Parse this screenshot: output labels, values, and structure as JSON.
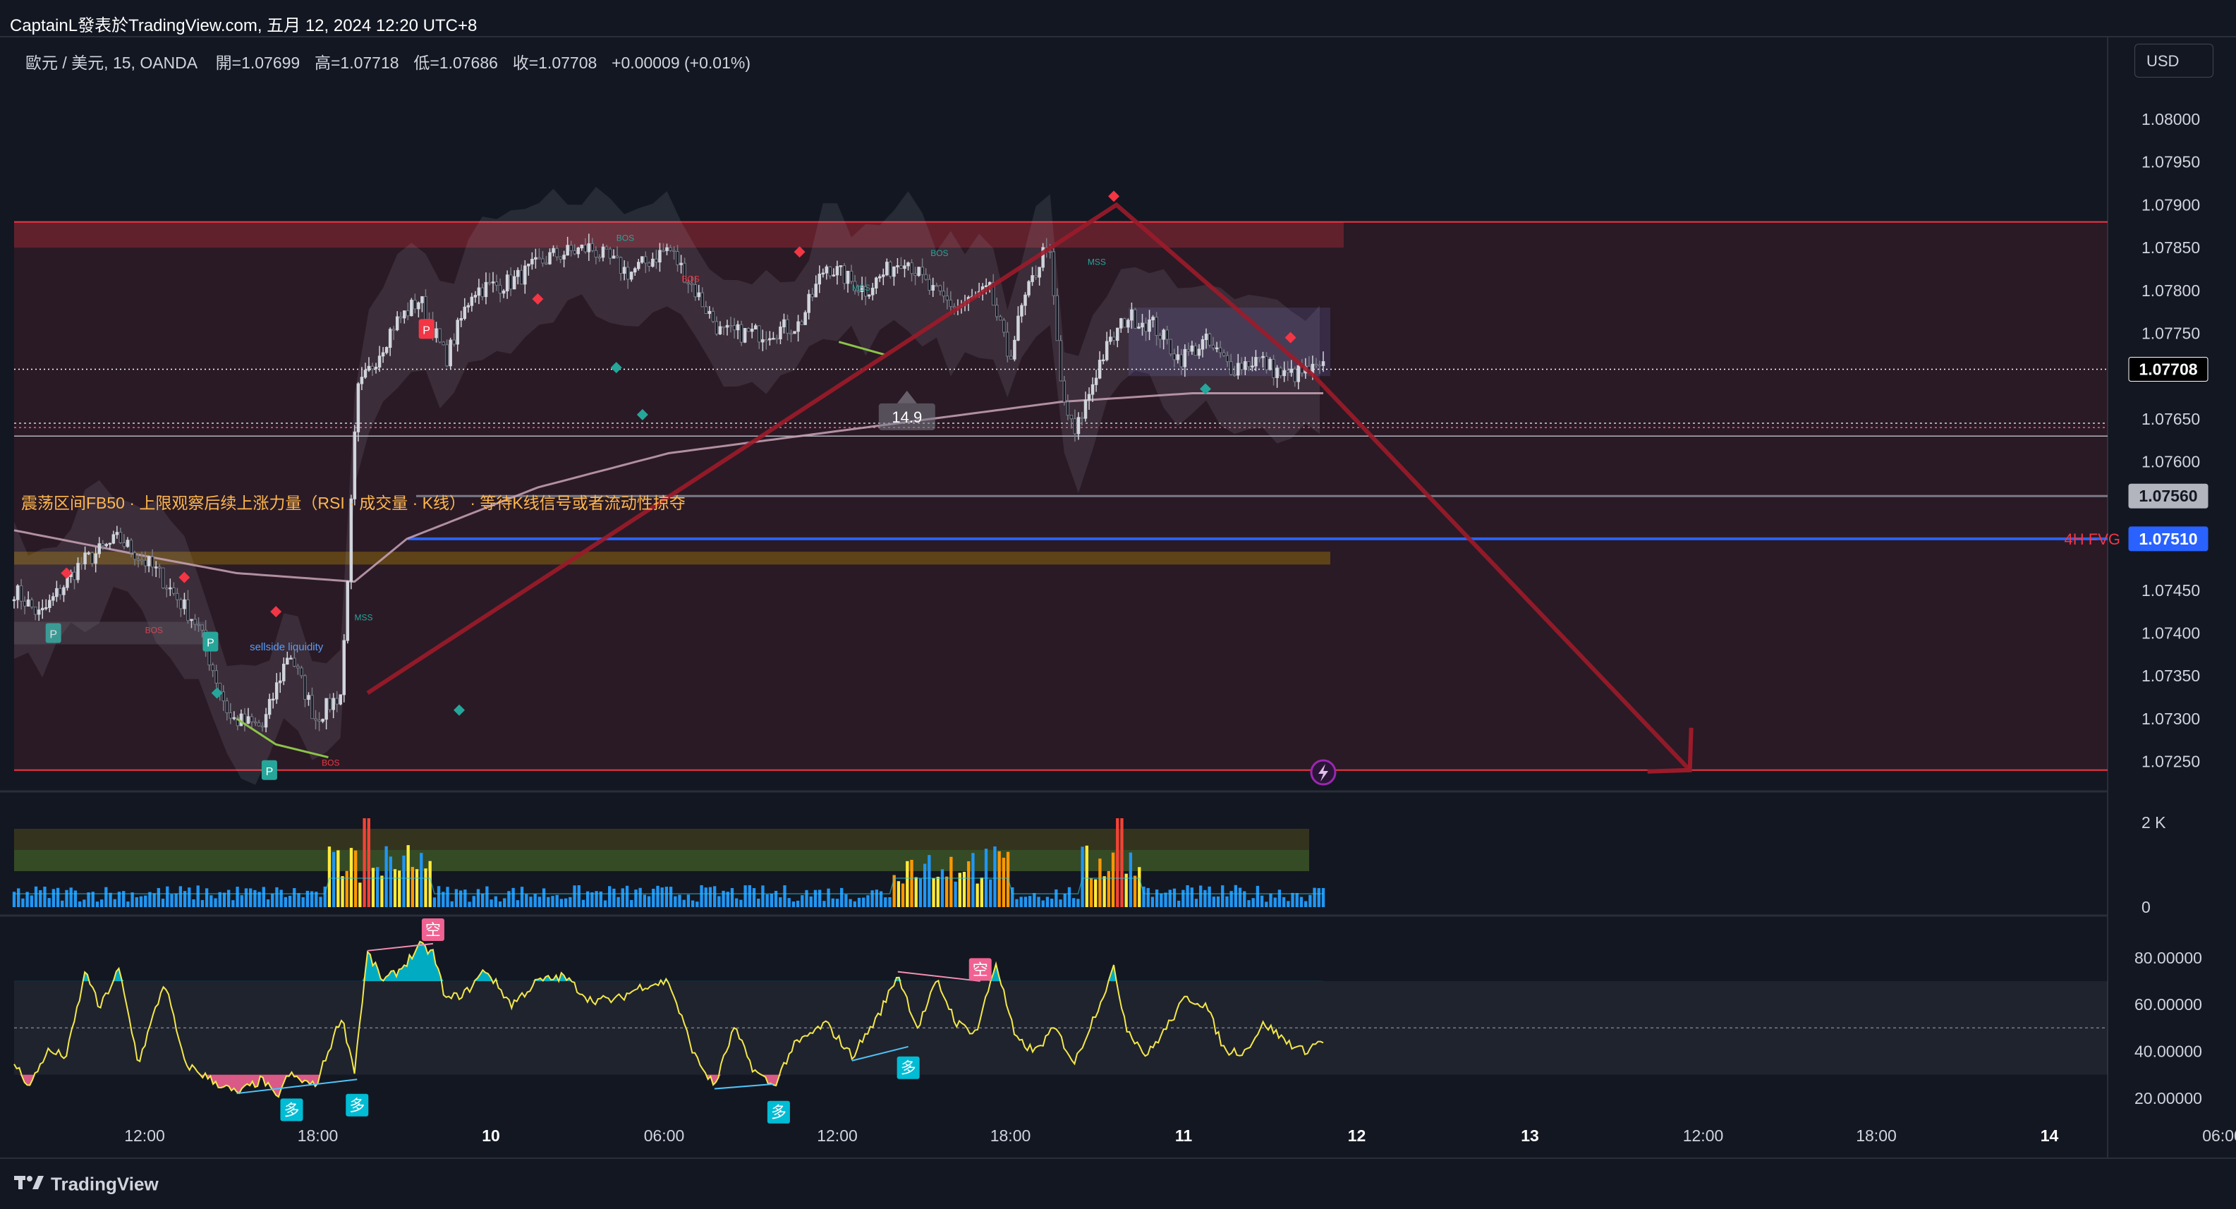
{
  "header": {
    "published": "CaptainL發表於TradingView.com, 五月 12, 2024 12:20 UTC+8",
    "symbol": "歐元 / 美元, 15, OANDA",
    "open_label": "開=",
    "open": "1.07699",
    "high_label": "高=",
    "high": "1.07718",
    "low_label": "低=",
    "low": "1.07686",
    "close_label": "收=",
    "close": "1.07708",
    "change": "+0.00009 (+0.01%)"
  },
  "currency_button": "USD",
  "footer": {
    "logo_text": "TradingView"
  },
  "annotations": {
    "range_note": "震荡区间FB50 · 上限观察后续上涨力量（RSI · 成交量 · K线） · 等待K线信号或者流动性掠夺",
    "fvg_label": "4H FVG",
    "measure_value": "14.9",
    "marks": {
      "bos": "BOS",
      "mss": "MSS",
      "p": "P",
      "sellside": "sellside liquidity",
      "long": "多",
      "short": "空"
    }
  },
  "colors": {
    "background": "#131722",
    "up": "#d1d4dc",
    "down": "#787b86",
    "zone_red": "#f23645",
    "fvg_line": "#2962ff",
    "ma_line": "#c9a4b8",
    "arrow": "#9c1b2a",
    "rsi_line": "#f5e84a",
    "rsi_short": "#f06292",
    "rsi_long": "#00bcd4",
    "vol_blue": "#2196f3",
    "vol_yellow": "#ffeb3b",
    "vol_orange": "#ff9800",
    "vol_red": "#f44336"
  },
  "chart_data": [
    {
      "type": "candlestick",
      "pane": "price",
      "symbol": "EUR/USD",
      "timeframe": "15",
      "ylim": [
        1.07225,
        1.08065
      ],
      "y_ticks": [
        "1.08000",
        "1.07950",
        "1.07900",
        "1.07850",
        "1.07800",
        "1.07750",
        "1.07650",
        "1.07600",
        "1.07450",
        "1.07400",
        "1.07350",
        "1.07300",
        "1.07250"
      ],
      "price_tags": [
        {
          "label": "1.07708",
          "value": 1.07708,
          "style": "last"
        },
        {
          "label": "1.07560",
          "value": 1.0756,
          "style": "grey"
        },
        {
          "label": "1.07510",
          "value": 1.0751,
          "style": "blue"
        }
      ],
      "x_ticks": [
        "12:00",
        "18:00",
        "10",
        "06:00",
        "12:00",
        "18:00",
        "11",
        "12",
        "13",
        "12:00",
        "18:00",
        "14",
        "06:00"
      ],
      "close_path": [
        [
          0.0,
          1.0745
        ],
        [
          0.02,
          1.0742
        ],
        [
          0.05,
          1.0748
        ],
        [
          0.08,
          1.0751
        ],
        [
          0.11,
          1.0747
        ],
        [
          0.14,
          1.0741
        ],
        [
          0.165,
          1.073
        ],
        [
          0.19,
          1.0729
        ],
        [
          0.21,
          1.0738
        ],
        [
          0.23,
          1.073
        ],
        [
          0.25,
          1.0733
        ],
        [
          0.262,
          1.0768
        ],
        [
          0.29,
          1.0776
        ],
        [
          0.31,
          1.0779
        ],
        [
          0.33,
          1.0772
        ],
        [
          0.35,
          1.078
        ],
        [
          0.38,
          1.0781
        ],
        [
          0.41,
          1.0784
        ],
        [
          0.44,
          1.0785
        ],
        [
          0.47,
          1.0782
        ],
        [
          0.5,
          1.0785
        ],
        [
          0.52,
          1.078
        ],
        [
          0.54,
          1.0775
        ],
        [
          0.57,
          1.0775
        ],
        [
          0.6,
          1.0776
        ],
        [
          0.62,
          1.0783
        ],
        [
          0.65,
          1.078
        ],
        [
          0.68,
          1.0784
        ],
        [
          0.7,
          1.078
        ],
        [
          0.72,
          1.0778
        ],
        [
          0.745,
          1.078
        ],
        [
          0.76,
          1.0772
        ],
        [
          0.77,
          1.0778
        ],
        [
          0.79,
          1.0786
        ],
        [
          0.8,
          1.0768
        ],
        [
          0.81,
          1.0763
        ],
        [
          0.83,
          1.0772
        ],
        [
          0.85,
          1.0777
        ],
        [
          0.87,
          1.0776
        ],
        [
          0.89,
          1.0772
        ],
        [
          0.91,
          1.0774
        ],
        [
          0.93,
          1.0771
        ],
        [
          0.95,
          1.0772
        ],
        [
          0.97,
          1.077
        ],
        [
          1.0,
          1.07708
        ]
      ],
      "zones": [
        {
          "name": "range-top",
          "from": 1.0785,
          "to": 1.0788
        },
        {
          "name": "range",
          "from": 1.0724,
          "to": 1.0788
        },
        {
          "name": "fvg-band",
          "from": 1.0748,
          "to": 1.07495
        },
        {
          "name": "consolidation-box",
          "from": 1.077,
          "to": 1.0778
        }
      ],
      "levels": [
        {
          "name": "range-high",
          "value": 1.0788
        },
        {
          "name": "range-low",
          "value": 1.0724
        },
        {
          "name": "4h-fvg",
          "value": 1.0751
        },
        {
          "name": "mid-grey",
          "value": 1.0756
        },
        {
          "name": "dotted-1",
          "value": 1.07645
        },
        {
          "name": "dotted-2",
          "value": 1.0764
        },
        {
          "name": "solid-low",
          "value": 1.0763
        }
      ],
      "moving_average": [
        [
          0.0,
          1.0752
        ],
        [
          0.1,
          1.0749
        ],
        [
          0.17,
          1.0747
        ],
        [
          0.26,
          1.0746
        ],
        [
          0.3,
          1.0751
        ],
        [
          0.4,
          1.0757
        ],
        [
          0.5,
          1.0761
        ],
        [
          0.6,
          1.0763
        ],
        [
          0.7,
          1.0765
        ],
        [
          0.8,
          1.0767
        ],
        [
          0.9,
          1.0768
        ],
        [
          1.0,
          1.0768
        ]
      ],
      "drawing": {
        "type": "projection-arrow",
        "points": [
          [
            0.27,
            1.0733
          ],
          [
            0.842,
            1.079
          ],
          [
            0.993,
            1.077
          ],
          [
            1.28,
            1.0724
          ]
        ]
      }
    },
    {
      "type": "bar",
      "pane": "volume",
      "y_ticks": [
        "2 K",
        "0"
      ],
      "ylim": [
        0,
        2000
      ],
      "spikes": [
        {
          "at": 0.27,
          "value": 2000,
          "color": "red"
        },
        {
          "at": 0.845,
          "value": 2000,
          "color": "red"
        }
      ],
      "active_windows": [
        [
          0.24,
          0.32
        ],
        [
          0.67,
          0.76
        ],
        [
          0.815,
          0.86
        ]
      ]
    },
    {
      "type": "line",
      "pane": "rsi",
      "ylim": [
        10,
        95
      ],
      "y_ticks": [
        "80.00000",
        "60.00000",
        "40.00000",
        "20.00000"
      ],
      "bands": {
        "upper": 70,
        "mid": 50,
        "lower": 30
      },
      "values": [
        [
          0.0,
          35
        ],
        [
          0.012,
          25
        ],
        [
          0.025,
          40
        ],
        [
          0.04,
          38
        ],
        [
          0.055,
          75
        ],
        [
          0.065,
          58
        ],
        [
          0.08,
          75
        ],
        [
          0.095,
          35
        ],
        [
          0.115,
          70
        ],
        [
          0.13,
          35
        ],
        [
          0.15,
          28
        ],
        [
          0.17,
          22
        ],
        [
          0.19,
          28
        ],
        [
          0.2,
          20
        ],
        [
          0.21,
          30
        ],
        [
          0.23,
          25
        ],
        [
          0.25,
          55
        ],
        [
          0.26,
          32
        ],
        [
          0.27,
          82
        ],
        [
          0.282,
          70
        ],
        [
          0.295,
          75
        ],
        [
          0.31,
          85
        ],
        [
          0.32,
          82
        ],
        [
          0.33,
          62
        ],
        [
          0.345,
          65
        ],
        [
          0.36,
          75
        ],
        [
          0.38,
          60
        ],
        [
          0.4,
          70
        ],
        [
          0.42,
          72
        ],
        [
          0.44,
          62
        ],
        [
          0.46,
          62
        ],
        [
          0.48,
          68
        ],
        [
          0.5,
          70
        ],
        [
          0.52,
          38
        ],
        [
          0.535,
          25
        ],
        [
          0.55,
          50
        ],
        [
          0.565,
          32
        ],
        [
          0.58,
          25
        ],
        [
          0.595,
          42
        ],
        [
          0.62,
          52
        ],
        [
          0.64,
          38
        ],
        [
          0.66,
          55
        ],
        [
          0.675,
          73
        ],
        [
          0.69,
          50
        ],
        [
          0.705,
          70
        ],
        [
          0.72,
          52
        ],
        [
          0.735,
          48
        ],
        [
          0.75,
          78
        ],
        [
          0.765,
          45
        ],
        [
          0.78,
          40
        ],
        [
          0.795,
          50
        ],
        [
          0.81,
          35
        ],
        [
          0.825,
          55
        ],
        [
          0.84,
          75
        ],
        [
          0.85,
          50
        ],
        [
          0.865,
          38
        ],
        [
          0.88,
          50
        ],
        [
          0.895,
          63
        ],
        [
          0.91,
          60
        ],
        [
          0.925,
          40
        ],
        [
          0.94,
          40
        ],
        [
          0.955,
          52
        ],
        [
          0.97,
          45
        ],
        [
          0.985,
          40
        ],
        [
          1.0,
          45
        ]
      ],
      "signals": [
        {
          "label": "空",
          "at": 0.32,
          "value": 92,
          "kind": "short"
        },
        {
          "label": "空",
          "at": 0.738,
          "value": 75,
          "kind": "short"
        },
        {
          "label": "多",
          "at": 0.212,
          "value": 15,
          "kind": "long"
        },
        {
          "label": "多",
          "at": 0.262,
          "value": 17,
          "kind": "long"
        },
        {
          "label": "多",
          "at": 0.584,
          "value": 14,
          "kind": "long"
        },
        {
          "label": "多",
          "at": 0.683,
          "value": 33,
          "kind": "long"
        }
      ]
    }
  ]
}
